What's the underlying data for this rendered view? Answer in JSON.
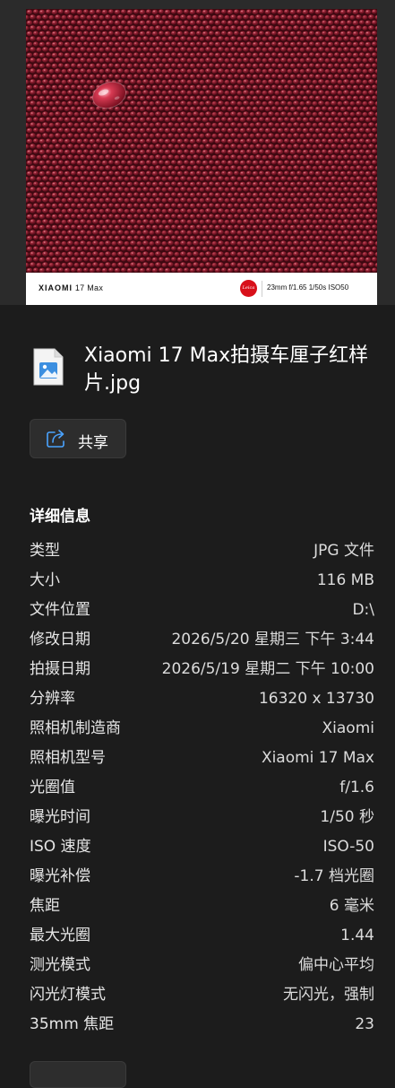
{
  "photo": {
    "brand_main": "XIAOMI",
    "brand_model": "17 Max",
    "leica_text": "Leica",
    "specs": "23mm  f/1.65  1/50s  ISO50",
    "colors": {
      "background": "#5a0f1c",
      "bean_dark": "#6b1322",
      "bean_mid": "#8e1f30",
      "bean_light": "#b23a4c",
      "highlight": "#e88a97",
      "leica_red": "#d8101a"
    }
  },
  "file": {
    "icon": "image-file-icon",
    "title": "Xiaomi 17 Max拍摄车厘子红样片.jpg"
  },
  "share": {
    "icon": "share-icon",
    "label": "共享"
  },
  "details": {
    "heading": "详细信息",
    "rows": [
      {
        "label": "类型",
        "value": "JPG 文件"
      },
      {
        "label": "大小",
        "value": "116 MB"
      },
      {
        "label": "文件位置",
        "value": "D:\\"
      },
      {
        "label": "修改日期",
        "value": "2026/5/20 星期三 下午 3:44"
      },
      {
        "label": "拍摄日期",
        "value": "2026/5/19 星期二 下午 10:00"
      },
      {
        "label": "分辨率",
        "value": "16320 x 13730"
      },
      {
        "label": "照相机制造商",
        "value": "Xiaomi"
      },
      {
        "label": "照相机型号",
        "value": "Xiaomi 17 Max"
      },
      {
        "label": "光圈值",
        "value": "f/1.6"
      },
      {
        "label": "曝光时间",
        "value": "1/50 秒"
      },
      {
        "label": "ISO 速度",
        "value": "ISO-50"
      },
      {
        "label": "曝光补偿",
        "value": "-1.7 档光圈"
      },
      {
        "label": "焦距",
        "value": "6 毫米"
      },
      {
        "label": "最大光圈",
        "value": "1.44"
      },
      {
        "label": "测光模式",
        "value": "偏中心平均"
      },
      {
        "label": "闪光灯模式",
        "value": "无闪光，强制"
      },
      {
        "label": "35mm 焦距",
        "value": "23"
      }
    ]
  },
  "theme": {
    "panel_background": "#1c1c1c",
    "preview_background": "#2b2b2b",
    "button_background": "#2d2d2d",
    "accent_blue": "#3c8fe0"
  }
}
